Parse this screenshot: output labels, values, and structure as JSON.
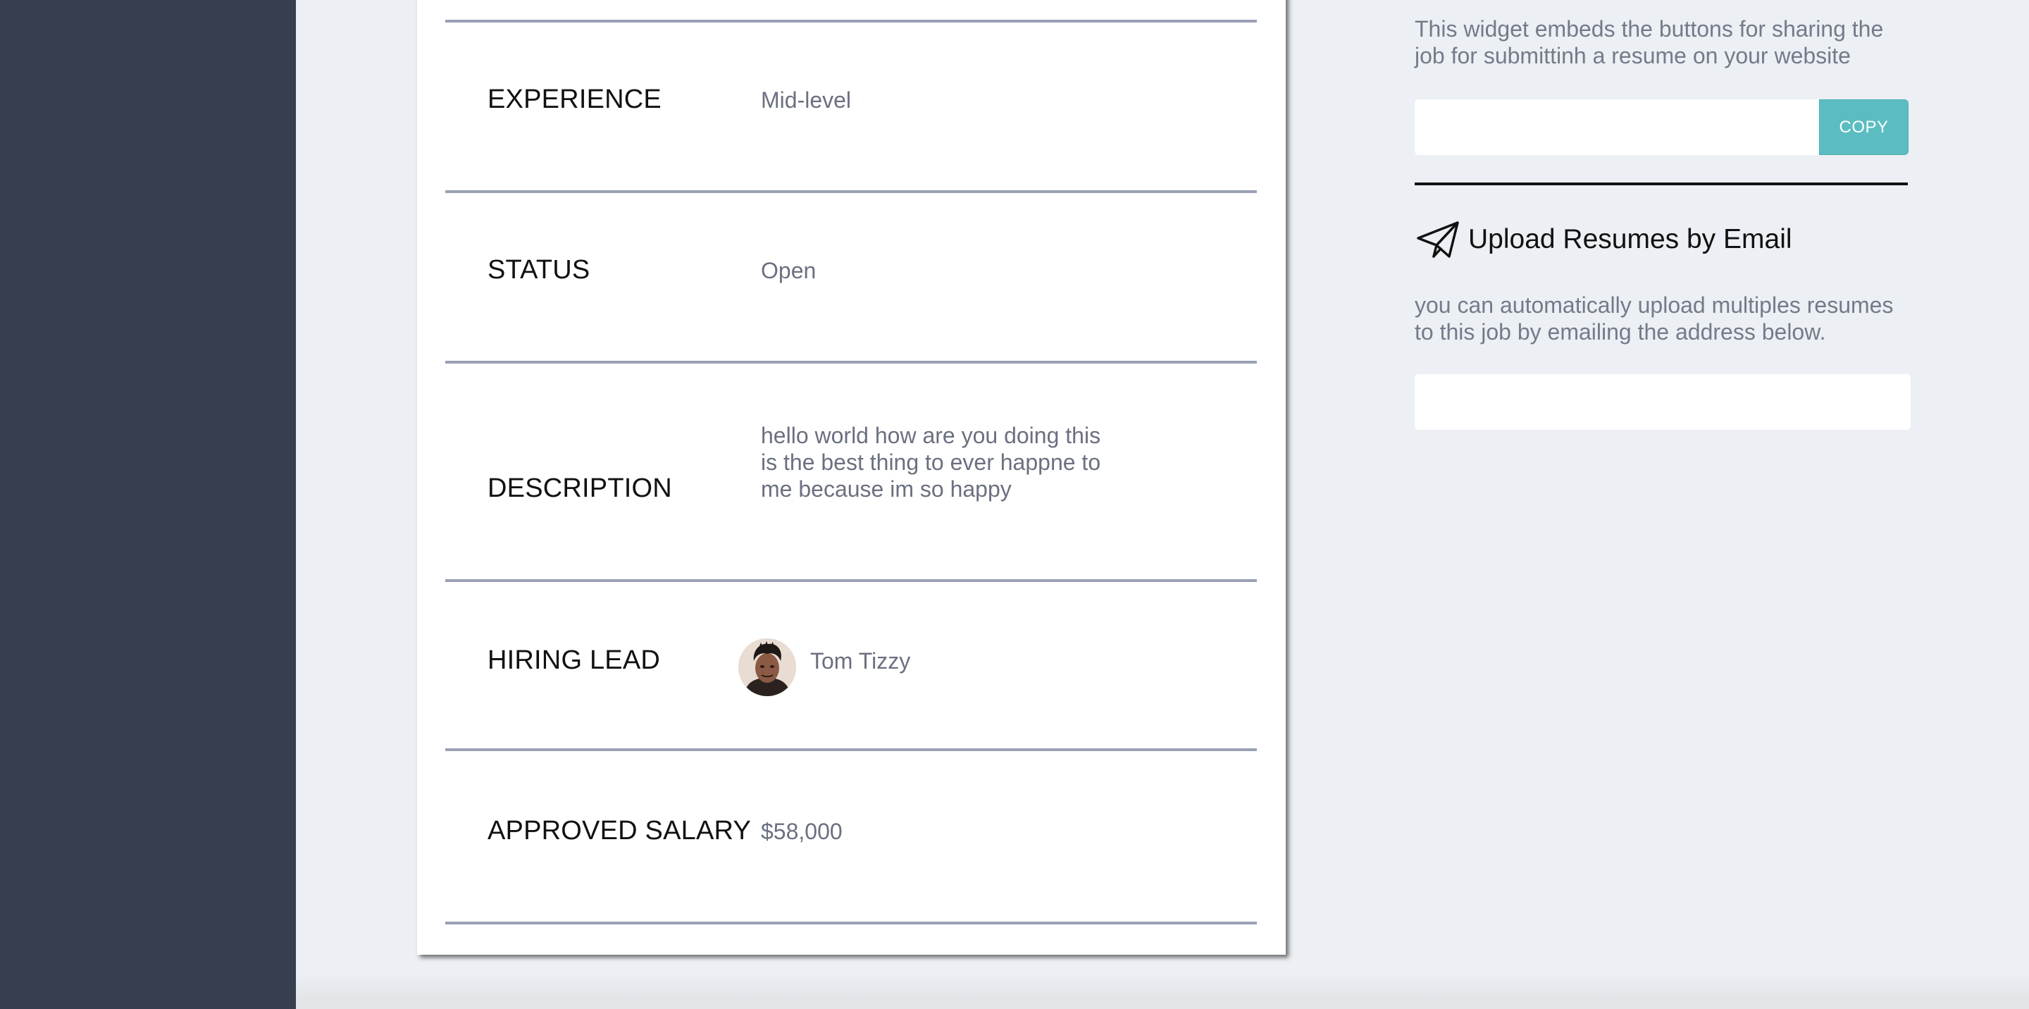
{
  "job_details": {
    "rows": [
      {
        "label": "EXPERIENCE",
        "value": "Mid-level"
      },
      {
        "label": "STATUS",
        "value": "Open"
      },
      {
        "label": "DESCRIPTION",
        "value": "hello world how are you doing this is the best thing to ever happne to me because im so happy"
      },
      {
        "label": "HIRING LEAD",
        "value": "Tom Tizzy"
      },
      {
        "label": "APPROVED SALARY",
        "value": "$58,000"
      }
    ]
  },
  "share_widget": {
    "description": "This widget embeds the buttons for sharing the job for submittinh a resume on your website",
    "input_value": "",
    "copy_label": "COPY",
    "icon": "share-widget"
  },
  "upload_by_email": {
    "title": "Upload Resumes by Email",
    "icon": "paper-plane-icon",
    "description": "you can automatically upload multiples resumes to this job by emailing the address below.",
    "email_value": ""
  },
  "colors": {
    "sidebar": "#363f4f",
    "background": "#eceff3",
    "accent": "#5bbdc1",
    "rule": "#9aa0b5",
    "value_text": "#6b7080"
  }
}
